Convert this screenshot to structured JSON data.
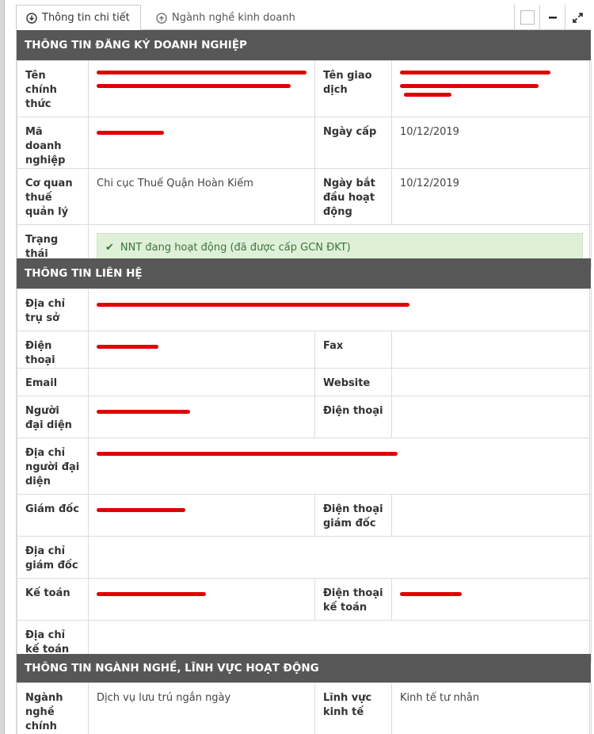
{
  "tabs": [
    {
      "label": "Thông tin chi tiết",
      "icon": "download-circle-icon",
      "active": true
    },
    {
      "label": "Ngành nghề kinh doanh",
      "icon": "upload-circle-icon",
      "active": false
    }
  ],
  "tool_icons": [
    "checkbox-icon",
    "minus-icon",
    "expand-icon"
  ],
  "sections": {
    "registration": {
      "title": "THÔNG TIN ĐĂNG KÝ DOANH NGHIỆP",
      "labels": {
        "official_name": "Tên chính thức",
        "trade_name": "Tên giao dịch",
        "tax_id": "Mã doanh nghiệp",
        "issue_date": "Ngày cấp",
        "tax_office": "Cơ quan thuế quản lý",
        "start_date": "Ngày bắt đầu hoạt động",
        "status": "Trạng thái"
      },
      "values": {
        "issue_date": "10/12/2019",
        "tax_office": "Chi cục Thuế Quận Hoàn Kiếm",
        "start_date": "10/12/2019",
        "status": "NNT đang hoạt động (đã được cấp GCN ĐKT)"
      }
    },
    "contact": {
      "title": "THÔNG TIN LIÊN HỆ",
      "labels": {
        "hq_address": "Địa chỉ trụ sở",
        "phone": "Điện thoại",
        "fax": "Fax",
        "email": "Email",
        "website": "Website",
        "representative": "Người đại diện",
        "rep_phone": "Điện thoại",
        "rep_address": "Địa chỉ người đại diện",
        "director": "Giám đốc",
        "director_phone": "Điện thoại giám đốc",
        "director_address": "Địa chỉ giám đốc",
        "accountant": "Kế toán",
        "accountant_phone": "Điện thoại kế toán",
        "accountant_address": "Địa chỉ kế toán"
      }
    },
    "industry": {
      "title": "THÔNG TIN NGÀNH NGHỀ, LĨNH VỰC HOẠT ĐỘNG",
      "labels": {
        "main_industry": "Ngành nghề chính",
        "economic_sector": "Lĩnh vực kinh tế"
      },
      "values": {
        "main_industry": "Dịch vụ lưu trú ngắn ngày",
        "economic_sector": "Kinh tế tư nhân"
      }
    }
  },
  "colors": {
    "section_header": "#575757",
    "status_bg": "#dff0d8",
    "status_text": "#3c763d",
    "redaction": "#e00000"
  }
}
